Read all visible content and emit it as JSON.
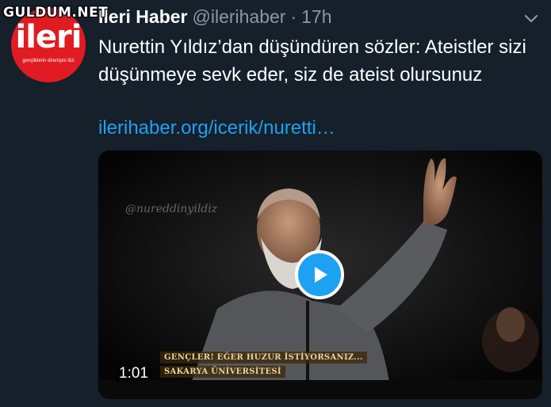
{
  "watermark": "GULDUM.NET",
  "avatar": {
    "logo_text": "ileri",
    "logo_sub": "gençliklerin direnişini ilizi"
  },
  "tweet": {
    "display_name": "İleri Haber",
    "handle": "@ilerihaber",
    "separator": "·",
    "time": "17h",
    "text": "Nurettin Yıldız’dan düşündüren sözler: Ateistler sizi düşünmeye sevk eder, siz de ateist olursunuz",
    "link": "ilerihaber.org/icerik/nuretti…"
  },
  "media": {
    "video_watermark": "@nureddinyildiz",
    "caption_line1": "GENÇLER! EĞER HUZUR İSTİYORSANIZ...",
    "caption_line2": "SAKARYA ÜNİVERSİTESİ",
    "duration": "1:01"
  },
  "icons": {
    "menu": "chevron-down-icon",
    "play": "play-icon"
  },
  "colors": {
    "background": "#15202b",
    "link": "#1da1f2",
    "muted": "#8899a6",
    "avatar_red": "#e11b22"
  }
}
